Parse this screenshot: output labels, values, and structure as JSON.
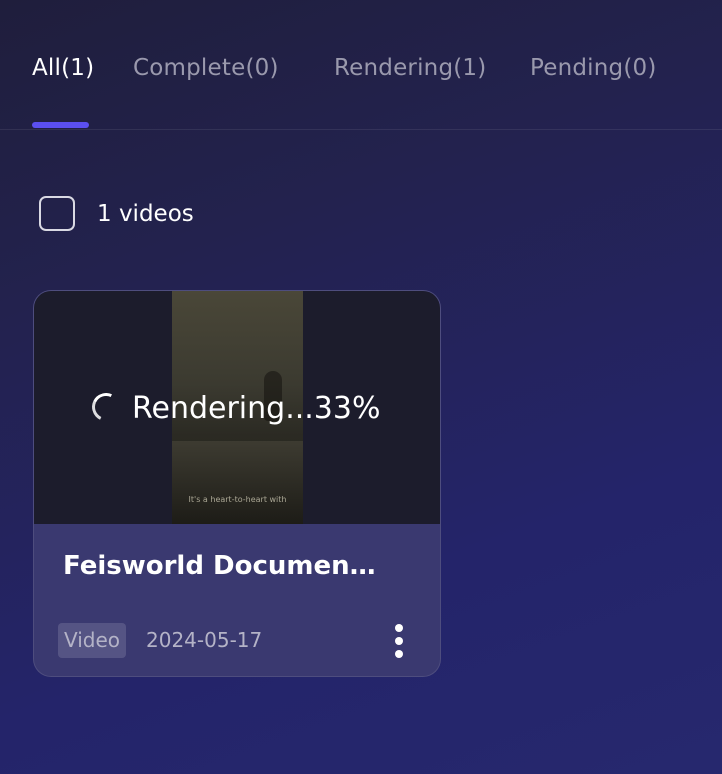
{
  "tabs": [
    {
      "label": "All(1)",
      "active": true
    },
    {
      "label": "Complete(0)",
      "active": false
    },
    {
      "label": "Rendering(1)",
      "active": false
    },
    {
      "label": "Pending(0)",
      "active": false
    }
  ],
  "selection": {
    "count_label": "1 videos"
  },
  "videos": [
    {
      "title": "Feisworld Document…",
      "status_text": "Rendering...33%",
      "progress_percent": 33,
      "type": "Video",
      "date": "2024-05-17",
      "thumbnail_caption": "It's a heart-to-heart with",
      "menu_icon": "more-vertical-icon"
    }
  ],
  "colors": {
    "accent": "#5b4ff0",
    "card_background": "#3a3970",
    "muted_text": "#b4b3c7"
  }
}
